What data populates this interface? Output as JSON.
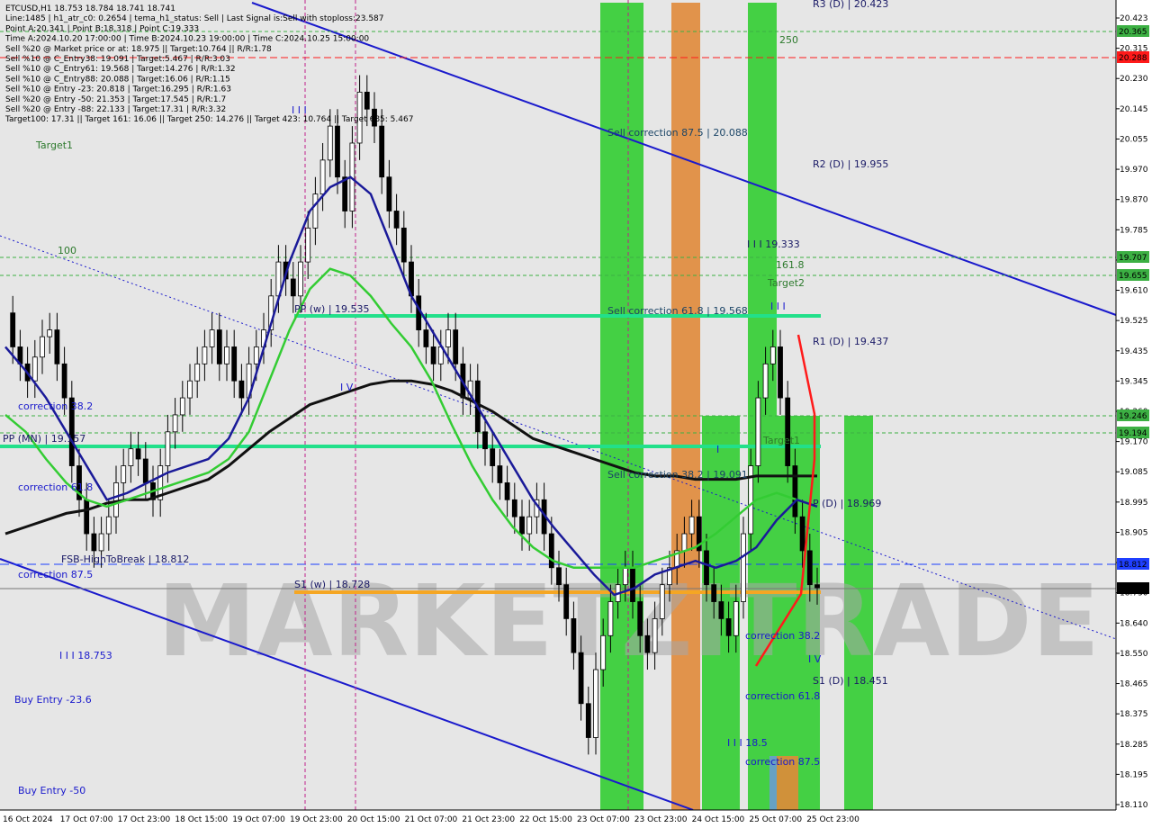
{
  "info_lines": [
    "ETCUSD,H1  18.753 18.784 18.741 18.741",
    "Line:1485 | h1_atr_c0: 0.2654 | tema_h1_status: Sell | Last Signal is:Sell with stoploss:23.587",
    "Point A:20.341 | Point B:18.318 | Point C:19.333",
    "Time A:2024.10.20 17:00:00 | Time B:2024.10.23 19:00:00 | Time C:2024.10.25 15:00:00",
    "Sell %20 @ Market price or at: 18.975 || Target:10.764 || R/R:1.78",
    "Sell %10 @ C_Entry38: 19.091 | Target:5.467 | R/R:3.03",
    "Sell %10 @ C_Entry61: 19.568 | Target:14.276 | R/R:1.32",
    "Sell %10 @ C_Entry88: 20.088 | Target:16.06 | R/R:1.15",
    "Sell %10 @ Entry -23: 20.818 | Target:16.295 | R/R:1.63",
    "Sell %20 @ Entry -50: 21.353 | Target:17.545 | R/R:1.7",
    "Sell %20 @ Entry -88: 22.133 | Target:17.31 | R/R:3.32",
    "Target100: 17.31 || Target 161: 16.06 || Target 250: 14.276 || Target 423: 10.764 || Target 685: 5.467"
  ],
  "chart_labels": {
    "target1": "Target1",
    "lbl_100": "100",
    "lbl_250": "250",
    "lbl_1618": "161.8",
    "target2": "Target2",
    "r3": "R3 (D) | 20.423",
    "r2": "R2 (D) | 19.955",
    "r1": "R1 (D) | 19.437",
    "p_d": "P (D) | 18.969",
    "s1_d": "S1 (D) | 18.451",
    "pp_w": "PP (w) | 19.535",
    "pp_mn": "PP (MN) | 19.157",
    "s1_w": "S1 (w) | 18.728",
    "sell_corr_875": "Sell correction 87.5 | 20.088",
    "sell_corr_618": "Sell correction 61.8 | 19.568",
    "sell_corr_382": "Sell correction 38.2 | 19.091",
    "corr_382_left": "correction 38.2",
    "corr_618_left": "correction 61.8",
    "corr_875_left": "correction 87.5",
    "fsb": "FSB-HighToBreak | 18.812",
    "wave_iii_top": "I I I",
    "wave_iv": "I V",
    "wave_iii_val": "I I I 18.753",
    "wave_c_val": "I I I 19.333",
    "wave_iii_small": "I I I",
    "wave_i": "I",
    "wave_185": "I I I 18.5",
    "corr_382_right": "correction 38.2",
    "corr_618_right": "correction 61.8",
    "corr_875_right": "correction 87.5",
    "wave_iv_right": "I V",
    "target_mid": "Target1",
    "buy_236": "Buy Entry -23.6",
    "buy_50": "Buy Entry -50",
    "watermark": "MARKETZITRADE"
  },
  "price_axis": {
    "ticks": [
      "20.423",
      "20.315",
      "20.230",
      "20.145",
      "20.055",
      "19.970",
      "19.870",
      "19.785",
      "19.695",
      "19.610",
      "19.525",
      "19.435",
      "19.345",
      "19.260",
      "19.170",
      "19.085",
      "18.995",
      "18.905",
      "18.820",
      "18.730",
      "18.640",
      "18.550",
      "18.465",
      "18.375",
      "18.285",
      "18.195",
      "18.110"
    ],
    "badges": [
      {
        "text": "20.365",
        "color": "#3cb043"
      },
      {
        "text": "20.288",
        "color": "#ff1a1a"
      },
      {
        "text": "19.707",
        "color": "#3cb043"
      },
      {
        "text": "19.655",
        "color": "#3cb043"
      },
      {
        "text": "19.246",
        "color": "#3cb043"
      },
      {
        "text": "19.194",
        "color": "#3cb043"
      },
      {
        "text": "18.812",
        "color": "#1f3fff"
      },
      {
        "text": "18.741",
        "color": "#000000"
      }
    ]
  },
  "time_axis": [
    "16 Oct 2024",
    "17 Oct 07:00",
    "17 Oct 23:00",
    "18 Oct 15:00",
    "19 Oct 07:00",
    "19 Oct 23:00",
    "20 Oct 15:00",
    "21 Oct 07:00",
    "21 Oct 23:00",
    "22 Oct 15:00",
    "23 Oct 07:00",
    "23 Oct 23:00",
    "24 Oct 15:00",
    "25 Oct 07:00",
    "25 Oct 23:00"
  ],
  "chart_data": {
    "type": "candlestick",
    "symbol": "ETCUSD",
    "timeframe": "H1",
    "ylim": [
      18.1,
      20.45
    ],
    "ohlc_last": {
      "open": 18.753,
      "high": 18.784,
      "low": 18.741,
      "close": 18.741
    },
    "close_series": [
      19.55,
      19.45,
      19.4,
      19.35,
      19.42,
      19.48,
      19.5,
      19.4,
      19.3,
      19.1,
      19.0,
      18.9,
      18.85,
      18.9,
      18.95,
      19.05,
      19.1,
      19.15,
      19.12,
      19.05,
      19.0,
      19.1,
      19.2,
      19.25,
      19.3,
      19.35,
      19.4,
      19.45,
      19.5,
      19.4,
      19.45,
      19.35,
      19.3,
      19.4,
      19.45,
      19.5,
      19.6,
      19.7,
      19.65,
      19.6,
      19.7,
      19.8,
      19.9,
      20.0,
      20.1,
      19.95,
      19.85,
      20.05,
      20.2,
      20.15,
      20.1,
      19.95,
      19.85,
      19.8,
      19.7,
      19.6,
      19.5,
      19.45,
      19.4,
      19.45,
      19.5,
      19.4,
      19.3,
      19.35,
      19.2,
      19.15,
      19.1,
      19.05,
      19.0,
      18.95,
      18.9,
      18.95,
      19.0,
      18.9,
      18.8,
      18.75,
      18.65,
      18.55,
      18.4,
      18.3,
      18.5,
      18.6,
      18.7,
      18.75,
      18.8,
      18.7,
      18.6,
      18.55,
      18.65,
      18.75,
      18.8,
      18.85,
      18.9,
      18.95,
      18.85,
      18.75,
      18.7,
      18.65,
      18.6,
      18.7,
      18.9,
      19.1,
      19.3,
      19.4,
      19.45,
      19.3,
      19.1,
      18.95,
      18.85,
      18.75,
      18.741
    ],
    "ma_blue": [
      19.45,
      19.38,
      19.3,
      19.2,
      19.1,
      19.0,
      19.02,
      19.05,
      19.08,
      19.1,
      19.12,
      19.18,
      19.3,
      19.5,
      19.7,
      19.85,
      19.92,
      19.95,
      19.9,
      19.75,
      19.6,
      19.5,
      19.4,
      19.3,
      19.2,
      19.1,
      19.0,
      18.92,
      18.85,
      18.78,
      18.72,
      18.74,
      18.78,
      18.8,
      18.82,
      18.8,
      18.82,
      18.86,
      18.94,
      19.0,
      18.98
    ],
    "ma_green": [
      19.25,
      19.2,
      19.12,
      19.05,
      19.0,
      18.98,
      19.0,
      19.02,
      19.04,
      19.06,
      19.08,
      19.12,
      19.2,
      19.35,
      19.5,
      19.62,
      19.68,
      19.66,
      19.6,
      19.52,
      19.45,
      19.35,
      19.22,
      19.1,
      19.0,
      18.92,
      18.86,
      18.82,
      18.8,
      18.8,
      18.8,
      18.8,
      18.82,
      18.84,
      18.86,
      18.9,
      18.95,
      19.0,
      19.02,
      19.0,
      18.98
    ],
    "ma_black": [
      18.9,
      18.92,
      18.94,
      18.96,
      18.97,
      18.99,
      19.0,
      19.0,
      19.02,
      19.04,
      19.06,
      19.1,
      19.15,
      19.2,
      19.24,
      19.28,
      19.3,
      19.32,
      19.34,
      19.35,
      19.35,
      19.34,
      19.32,
      19.29,
      19.26,
      19.22,
      19.18,
      19.16,
      19.14,
      19.12,
      19.1,
      19.08,
      19.07,
      19.07,
      19.06,
      19.06,
      19.06,
      19.07,
      19.07,
      19.07,
      19.07
    ]
  }
}
